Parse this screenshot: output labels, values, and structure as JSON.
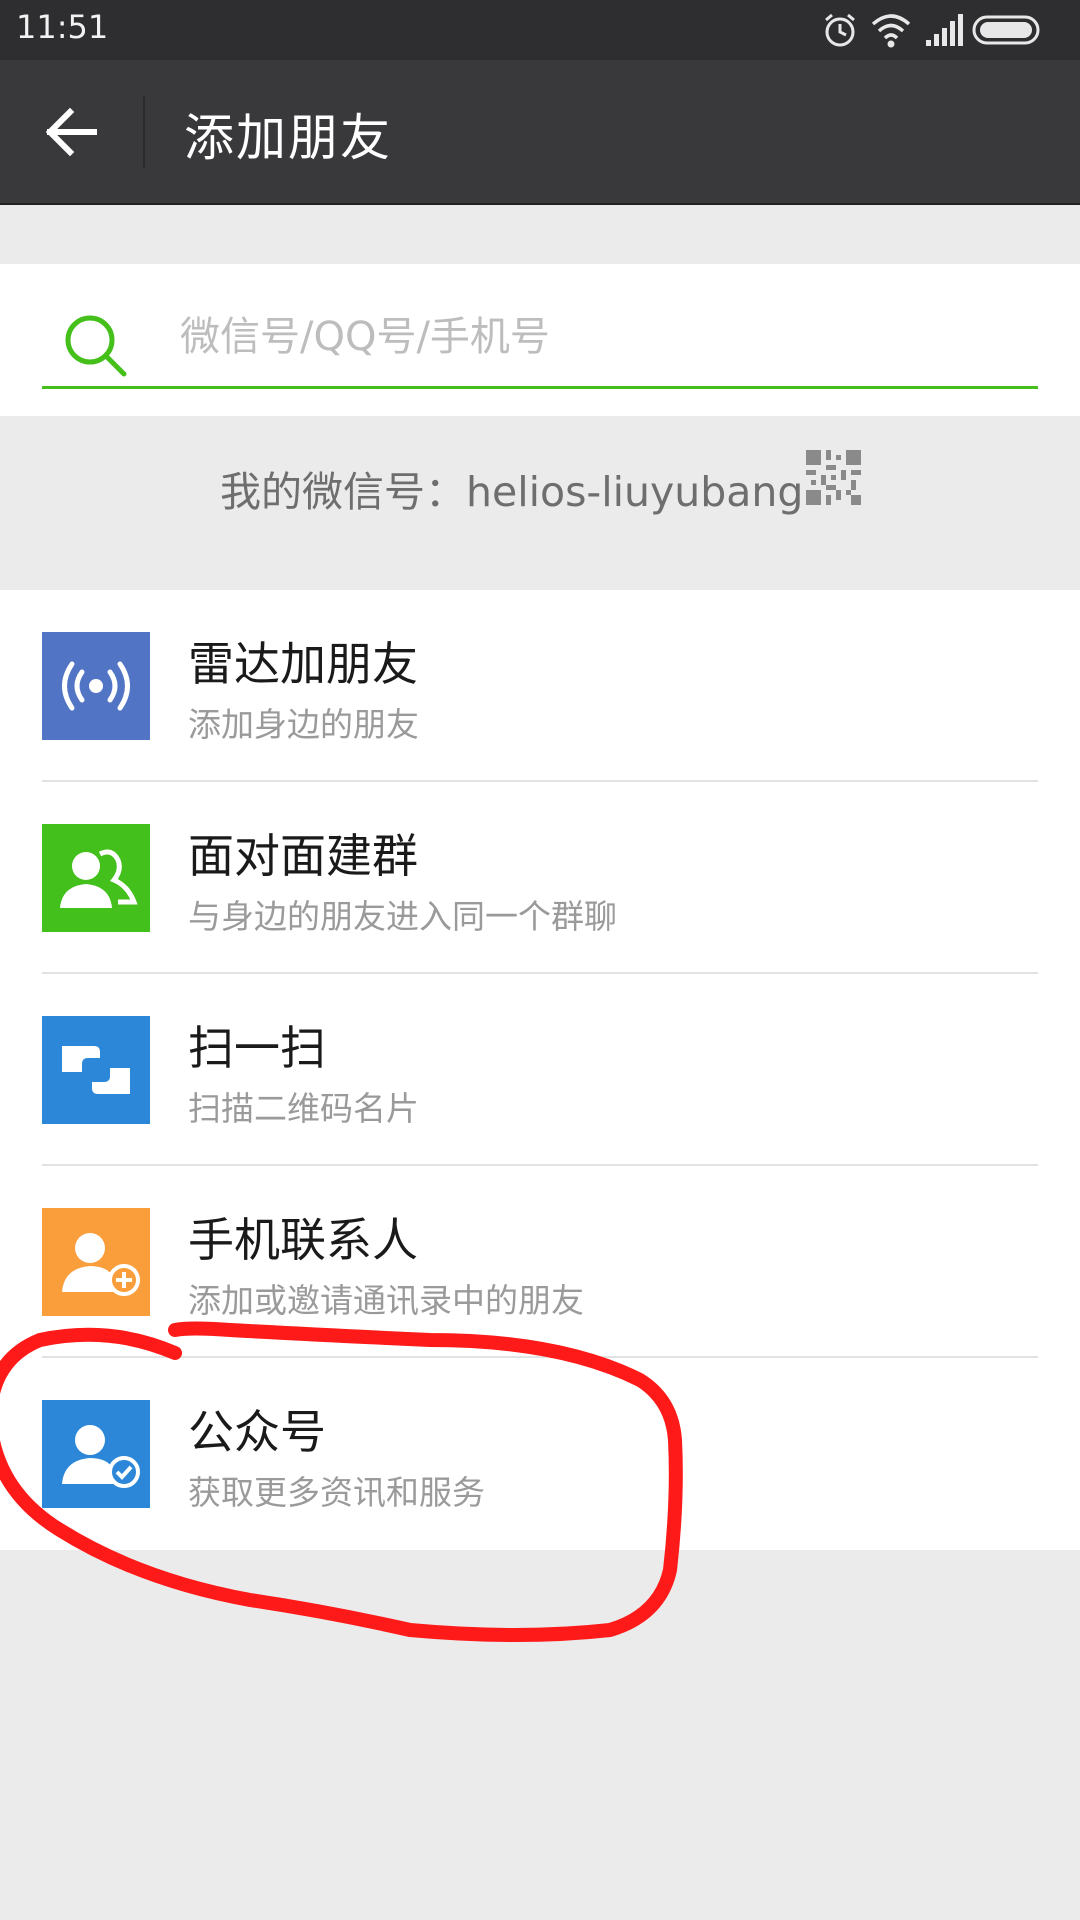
{
  "status_bar": {
    "time": "11:51"
  },
  "header": {
    "title": "添加朋友"
  },
  "search": {
    "placeholder": "微信号/QQ号/手机号",
    "value": ""
  },
  "my_id": {
    "label": "我的微信号：helios-liuyubang"
  },
  "menu": [
    {
      "title": "雷达加朋友",
      "subtitle": "添加身边的朋友",
      "icon": "radar-icon",
      "color": "#5274c4"
    },
    {
      "title": "面对面建群",
      "subtitle": "与身边的朋友进入同一个群聊",
      "icon": "group-icon",
      "color": "#44c01d"
    },
    {
      "title": "扫一扫",
      "subtitle": "扫描二维码名片",
      "icon": "scan-icon",
      "color": "#2d87d8"
    },
    {
      "title": "手机联系人",
      "subtitle": "添加或邀请通讯录中的朋友",
      "icon": "contact-add-icon",
      "color": "#fa9d3b"
    },
    {
      "title": "公众号",
      "subtitle": "获取更多资讯和服务",
      "icon": "official-account-icon",
      "color": "#2d87d8"
    }
  ],
  "colors": {
    "accent": "#45c01a",
    "header_bg": "#39393c",
    "annotation": "#ff1a1a"
  }
}
